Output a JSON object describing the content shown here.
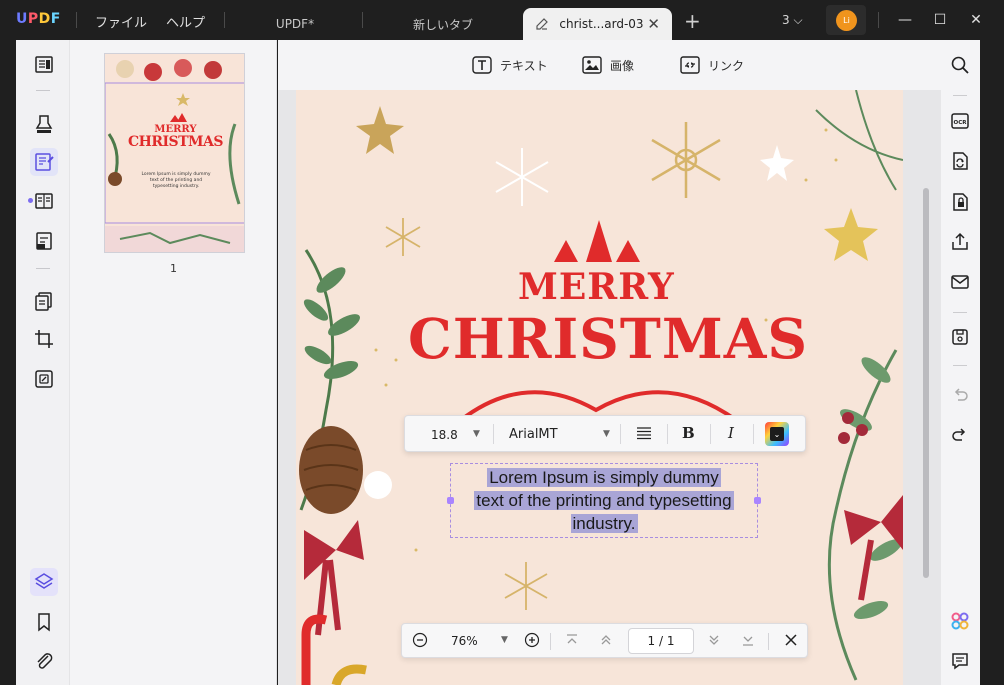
{
  "app": {
    "logo": "UPDF",
    "menu": [
      "ファイル",
      "ヘルプ"
    ]
  },
  "tabs": [
    {
      "label": "UPDF*",
      "active": false
    },
    {
      "label": "新しいタブ",
      "active": false
    },
    {
      "label": "christ...ard-03",
      "active": true
    }
  ],
  "titlebar": {
    "tab_count": "3",
    "avatar_initials": "Li"
  },
  "edit_tools": [
    "テキスト",
    "画像",
    "リンク"
  ],
  "thumbnail": {
    "page_number": "1",
    "title_merry": "MERRY",
    "title_christmas": "CHRISTMAS",
    "body": "Lorem Ipsum is simply dummy text of the printing and typesetting industry."
  },
  "document": {
    "title_merry": "MERRY",
    "title_christmas": "CHRISTMAS",
    "text_lines": [
      "Lorem Ipsum is simply dummy",
      "text of the printing and typesetting",
      "industry."
    ]
  },
  "format_bar": {
    "font_size": "18.8",
    "font_name": "ArialMT",
    "bold_label": "B",
    "italic_label": "I"
  },
  "zoom_bar": {
    "zoom": "76%",
    "page_current": "1",
    "page_sep": "/",
    "page_total": "1"
  },
  "colors": {
    "accent": "#7c6cf0",
    "title_red": "#e02b2b",
    "selection": "#a9a5d6",
    "avatar": "#f0941d"
  },
  "icons": {
    "left_bar": [
      "reader-icon",
      "comment-icon",
      "edit-pdf-icon",
      "page-view-icon",
      "form-icon",
      "organize-pages-icon",
      "crop-icon",
      "watermark-icon",
      "layers-icon",
      "bookmark-icon",
      "attachment-icon"
    ],
    "right_bar": [
      "search-icon",
      "ocr-icon",
      "convert-icon",
      "protect-icon",
      "share-icon",
      "mail-icon",
      "save-icon",
      "undo-icon",
      "redo-icon",
      "ai-assistant-icon",
      "chat-icon"
    ]
  }
}
